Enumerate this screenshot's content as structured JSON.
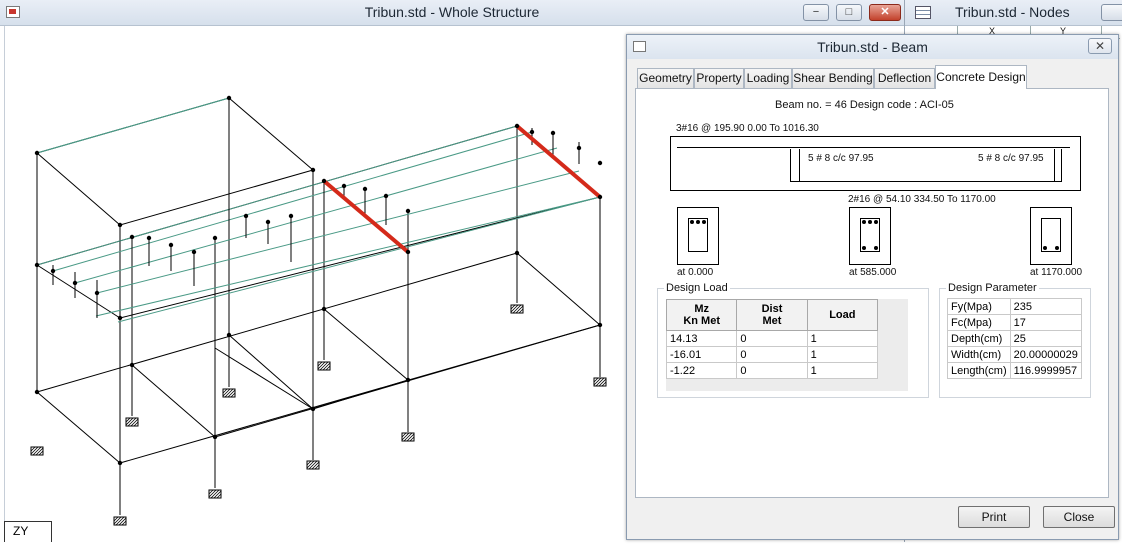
{
  "main_window": {
    "title": "Tribun.std - Whole Structure",
    "minimize": "−",
    "maximize": "□",
    "close": "✕",
    "axis_label": "ZY"
  },
  "nodes_window": {
    "title": "Tribun.std - Nodes",
    "col_x": "X",
    "col_y": "Y"
  },
  "beam_dialog": {
    "title": "Tribun.std - Beam",
    "close": "✕",
    "tabs": [
      "Geometry",
      "Property",
      "Loading",
      "Shear Bending",
      "Deflection",
      "Concrete Design"
    ],
    "active_tab": "Concrete Design",
    "beam_info": "Beam no. = 46  Design code :  ACI-05",
    "top_rebar": "3#16 @ 195.90 0.00 To 1016.30",
    "stirrup_left": "5 # 8 c/c 97.95",
    "stirrup_right": "5 # 8 c/c 97.95",
    "bottom_rebar": "2#16 @ 54.10 334.50 To 1170.00",
    "sections": [
      "at 0.000",
      "at 585.000",
      "at 1170.000"
    ],
    "design_load": {
      "legend": "Design Load",
      "headers": [
        "Mz\nKn Met",
        "Dist\nMet",
        "Load"
      ],
      "rows": [
        [
          "14.13",
          "0",
          "1"
        ],
        [
          "-16.01",
          "0",
          "1"
        ],
        [
          "-1.22",
          "0",
          "1"
        ]
      ]
    },
    "design_parameter": {
      "legend": "Design Parameter",
      "rows": [
        [
          "Fy(Mpa)",
          "235"
        ],
        [
          "Fc(Mpa)",
          "17"
        ],
        [
          "Depth(cm)",
          "25"
        ],
        [
          "Width(cm)",
          "20.00000029"
        ],
        [
          "Length(cm)",
          "116.9999957"
        ]
      ]
    },
    "print_button": "Print",
    "close_button": "Close"
  },
  "colors": {
    "frame": "#000000",
    "bracing": "#4a9a86",
    "selected_beam": "#d42a1a",
    "support": "#000000"
  }
}
